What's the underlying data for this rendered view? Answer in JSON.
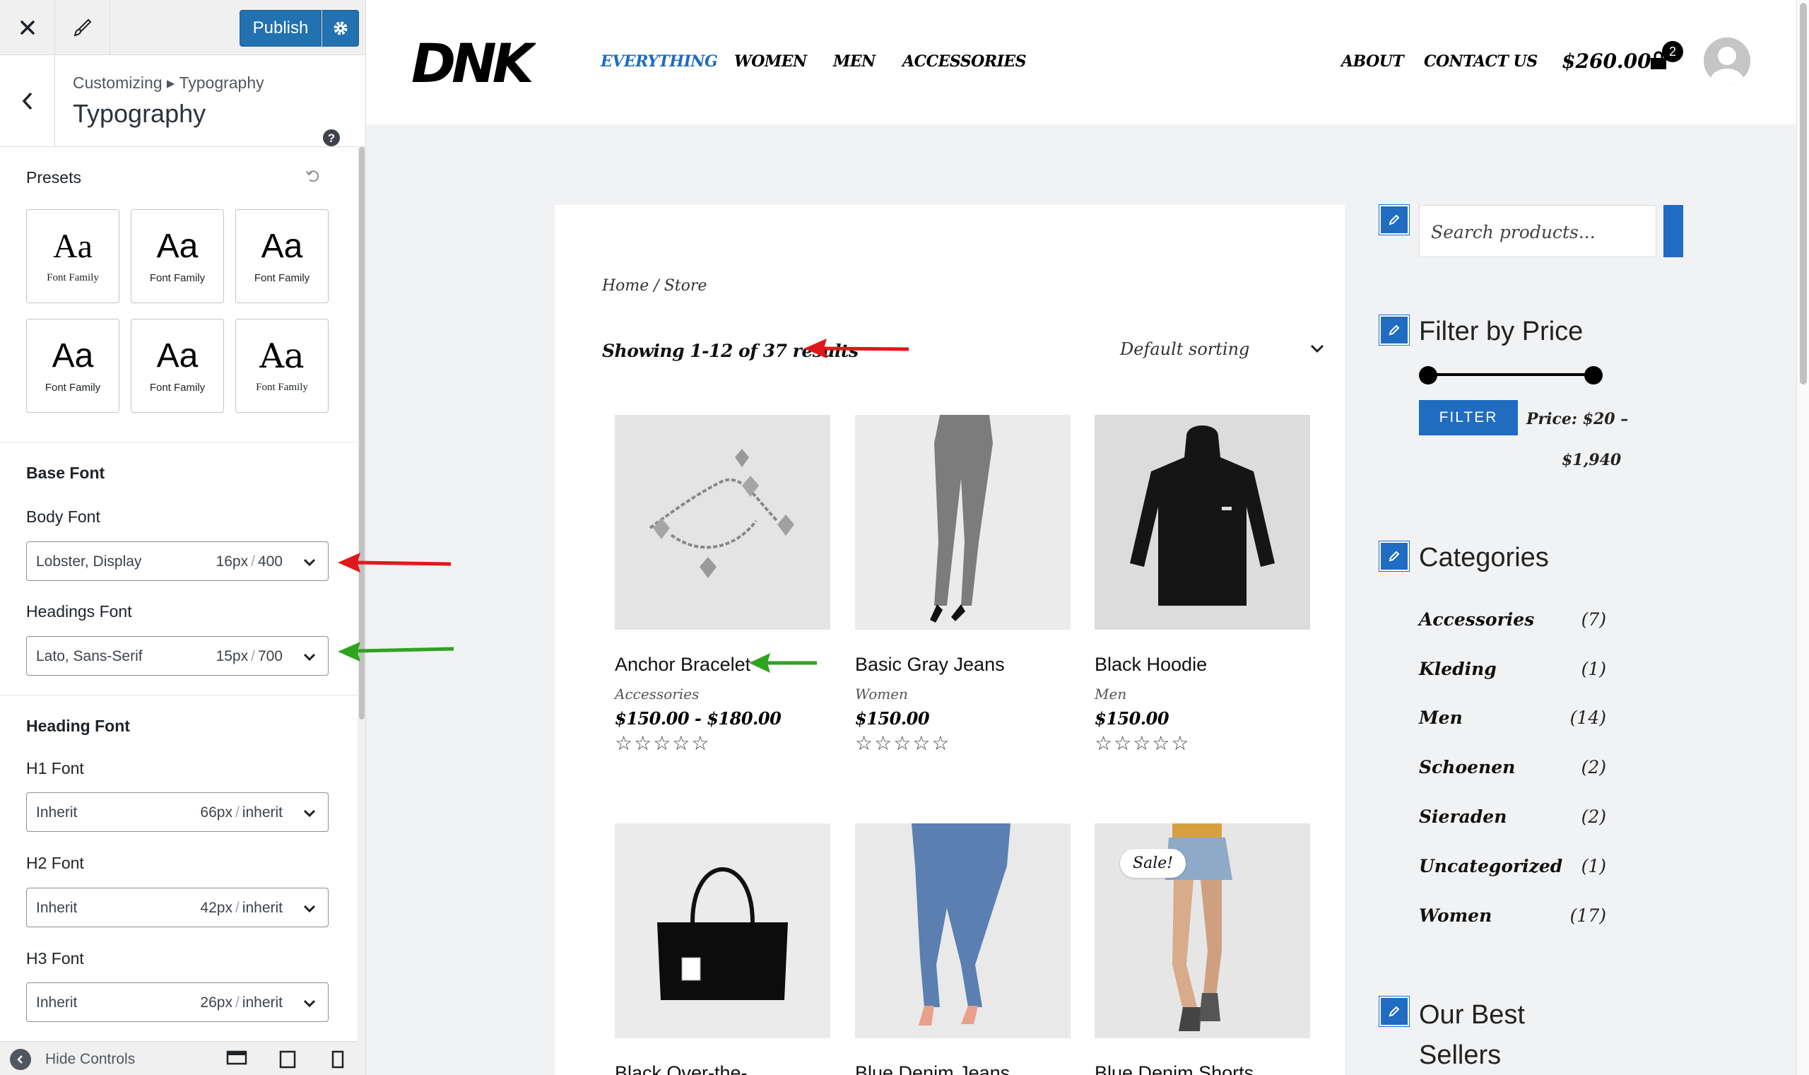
{
  "customizer": {
    "publish_label": "Publish",
    "breadcrumb": "Customizing ▸ Typography",
    "title": "Typography",
    "presets_label": "Presets",
    "presets": [
      {
        "aa": "Aa",
        "label": "Font Family"
      },
      {
        "aa": "Aa",
        "label": "Font Family"
      },
      {
        "aa": "Aa",
        "label": "Font Family"
      },
      {
        "aa": "Aa",
        "label": "Font Family"
      },
      {
        "aa": "Aa",
        "label": "Font Family"
      },
      {
        "aa": "Aa",
        "label": "Font Family"
      }
    ],
    "base_font_label": "Base Font",
    "body_font": {
      "label": "Body Font",
      "family": "Lobster, Display",
      "size": "16px",
      "weight": "400"
    },
    "headings_font": {
      "label": "Headings Font",
      "family": "Lato, Sans-Serif",
      "size": "15px",
      "weight": "700"
    },
    "heading_font_label": "Heading Font",
    "h1": {
      "label": "H1 Font",
      "family": "Inherit",
      "size": "66px",
      "weight": "inherit"
    },
    "h2": {
      "label": "H2 Font",
      "family": "Inherit",
      "size": "42px",
      "weight": "inherit"
    },
    "h3": {
      "label": "H3 Font",
      "family": "Inherit",
      "size": "26px",
      "weight": "inherit"
    },
    "hide_controls": "Hide Controls",
    "separator": "/"
  },
  "site": {
    "logo": "DNK",
    "nav": [
      "EVERYTHING",
      "WOMEN",
      "MEN",
      "ACCESSORIES"
    ],
    "secondary_nav": [
      "ABOUT",
      "CONTACT US"
    ],
    "cart_total": "$260.00",
    "cart_count": "2",
    "breadcrumb": "Home / Store",
    "results": "Showing 1-12 of 37 results",
    "sort": "Default sorting",
    "products": [
      {
        "name": "Anchor Bracelet",
        "category": "Accessories",
        "price": "$150.00 - $180.00",
        "stars": "☆☆☆☆☆"
      },
      {
        "name": "Basic Gray Jeans",
        "category": "Women",
        "price": "$150.00",
        "stars": "☆☆☆☆☆"
      },
      {
        "name": "Black Hoodie",
        "category": "Men",
        "price": "$150.00",
        "stars": "☆☆☆☆☆"
      },
      {
        "name": "Black Over-the-",
        "category": "",
        "price": "",
        "stars": ""
      },
      {
        "name": "Blue Denim Jeans",
        "category": "",
        "price": "",
        "stars": ""
      },
      {
        "name": "Blue Denim Shorts",
        "category": "",
        "price": "",
        "stars": "",
        "badge": "Sale!"
      }
    ],
    "search_placeholder": "Search products...",
    "filter_title": "Filter by Price",
    "filter_button": "FILTER",
    "price_range_line1": "Price: $20 –",
    "price_range_line2": "$1,940",
    "categories_title": "Categories",
    "categories": [
      {
        "name": "Accessories",
        "count": "(7)"
      },
      {
        "name": "Kleding",
        "count": "(1)"
      },
      {
        "name": "Men",
        "count": "(14)"
      },
      {
        "name": "Schoenen",
        "count": "(2)"
      },
      {
        "name": "Sieraden",
        "count": "(2)"
      },
      {
        "name": "Uncategorized",
        "count": "(1)"
      },
      {
        "name": "Women",
        "count": "(17)"
      }
    ],
    "best_sellers_title_1": "Our Best",
    "best_sellers_title_2": "Sellers"
  },
  "colors": {
    "accent": "#1f6cc1",
    "wp_blue": "#2271b1",
    "arrow_red": "#e0181b",
    "arrow_green": "#2ea31f"
  }
}
